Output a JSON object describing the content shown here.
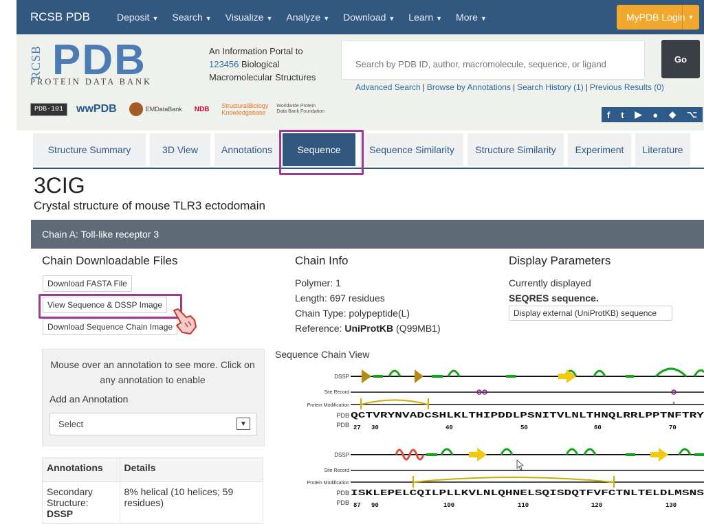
{
  "nav": {
    "brand": "RCSB PDB",
    "items": [
      "Deposit",
      "Search",
      "Visualize",
      "Analyze",
      "Download",
      "Learn",
      "More"
    ],
    "login": "MyPDB Login"
  },
  "header": {
    "logo_side": "RCSB",
    "logo_main": "PDB",
    "logo_sub": "PROTEIN DATA BANK",
    "tagline_1": "An Information Portal to",
    "count": "123456",
    "tagline_2": " Biological",
    "tagline_3": "Macromolecular Structures",
    "search_placeholder": "Search by PDB ID, author, macromolecule, sequence, or ligand",
    "go": "Go",
    "links": [
      "Advanced Search",
      "Browse by Annotations",
      "Search History (1)",
      "Previous Results (0)"
    ],
    "partners": [
      "PDB-101",
      "wwPDB",
      "EMDataBank",
      "NDB",
      "StructuralBiology Knowledgebase",
      "Worldwide Protein Data Bank Foundation"
    ],
    "social": [
      "f",
      "t",
      "▶",
      "",
      "",
      "⌥"
    ]
  },
  "tabs": [
    "Structure Summary",
    "3D View",
    "Annotations",
    "Sequence",
    "Sequence Similarity",
    "Structure Similarity",
    "Experiment",
    "Literature"
  ],
  "active_tab": "Sequence",
  "entry": {
    "id": "3CIG",
    "title": "Crystal structure of mouse TLR3 ectodomain"
  },
  "chain_header": "Chain A: Toll-like receptor 3",
  "downloads": {
    "heading": "Chain Downloadable Files",
    "buttons": [
      "Download FASTA File",
      "View Sequence & DSSP Image",
      "Download Sequence Chain Image"
    ]
  },
  "chain_info": {
    "heading": "Chain Info",
    "polymer_label": "Polymer: ",
    "polymer": "1",
    "length_label": "Length: ",
    "length": "697 residues",
    "type_label": "Chain Type: ",
    "type": "polypeptide(L)",
    "ref_label": "Reference: ",
    "ref_db": "UniProtKB",
    "ref_id": " (Q99MB1)"
  },
  "display": {
    "heading": "Display Parameters",
    "line1": "Currently displayed",
    "line2": "SEQRES sequence.",
    "button": "Display external (UniProtKB) sequence"
  },
  "annotation": {
    "hint": "Mouse over an annotation to see more. Click on any annotation to enable",
    "add": "Add an Annotation",
    "select": "Select",
    "table_headers": [
      "Annotations",
      "Details"
    ],
    "row_label_1": "Secondary",
    "row_label_2": "Structure: ",
    "row_label_bold": "DSSP",
    "row_detail": "8% helical (10 helices; 59 residues)"
  },
  "sequence_view": {
    "title": "Sequence Chain View",
    "track_labels": [
      "DSSP",
      "Site Record",
      "Protein Modification"
    ],
    "row1": {
      "seq": "QCTVRYNVADCSHLKLTHIPDDLPSNITVLNLTHNQLRRLPPTNFTRY",
      "ruler": [
        "PDB",
        "27",
        "30",
        "40",
        "50",
        "60",
        "70"
      ]
    },
    "row2": {
      "seq": "ISKLEPELCQILPLLKVLNLQHNELSQISDQTFVFCTNLTELDLMSNS",
      "ruler": [
        "PDB",
        "87",
        "90",
        "100",
        "110",
        "120",
        "130"
      ]
    },
    "colors": {
      "strand": "#f2c811",
      "turn": "#19a41e",
      "helix": "#e14b3a",
      "site": "#8a1a8a",
      "mod": "#d4a800",
      "dark_gold": "#b58a12"
    }
  }
}
